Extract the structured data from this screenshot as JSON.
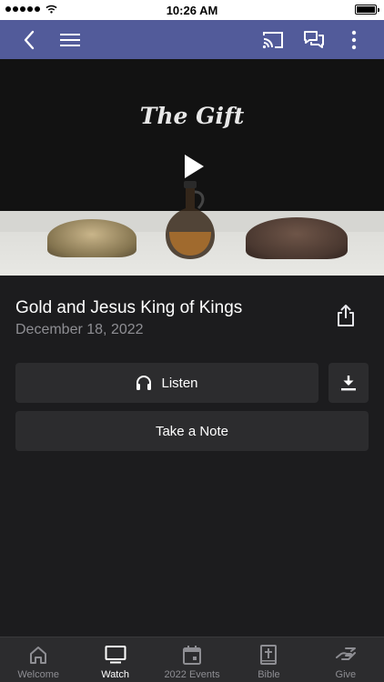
{
  "status_bar": {
    "time": "10:26 AM"
  },
  "nav": {
    "icons": [
      "back-icon",
      "menu-icon",
      "cast-icon",
      "chat-icon",
      "more-vertical-icon"
    ],
    "accent": "#525b9a"
  },
  "video": {
    "title_card": "The Gift"
  },
  "sermon": {
    "title": "Gold and Jesus King of Kings",
    "date": "December 18, 2022"
  },
  "actions": {
    "listen_label": "Listen",
    "note_label": "Take a Note"
  },
  "tabs": [
    {
      "label": "Welcome",
      "icon": "home-icon",
      "active": false
    },
    {
      "label": "Watch",
      "icon": "tv-icon",
      "active": true
    },
    {
      "label": "2022 Events",
      "icon": "calendar-icon",
      "active": false
    },
    {
      "label": "Bible",
      "icon": "bible-icon",
      "active": false
    },
    {
      "label": "Give",
      "icon": "give-icon",
      "active": false
    }
  ]
}
